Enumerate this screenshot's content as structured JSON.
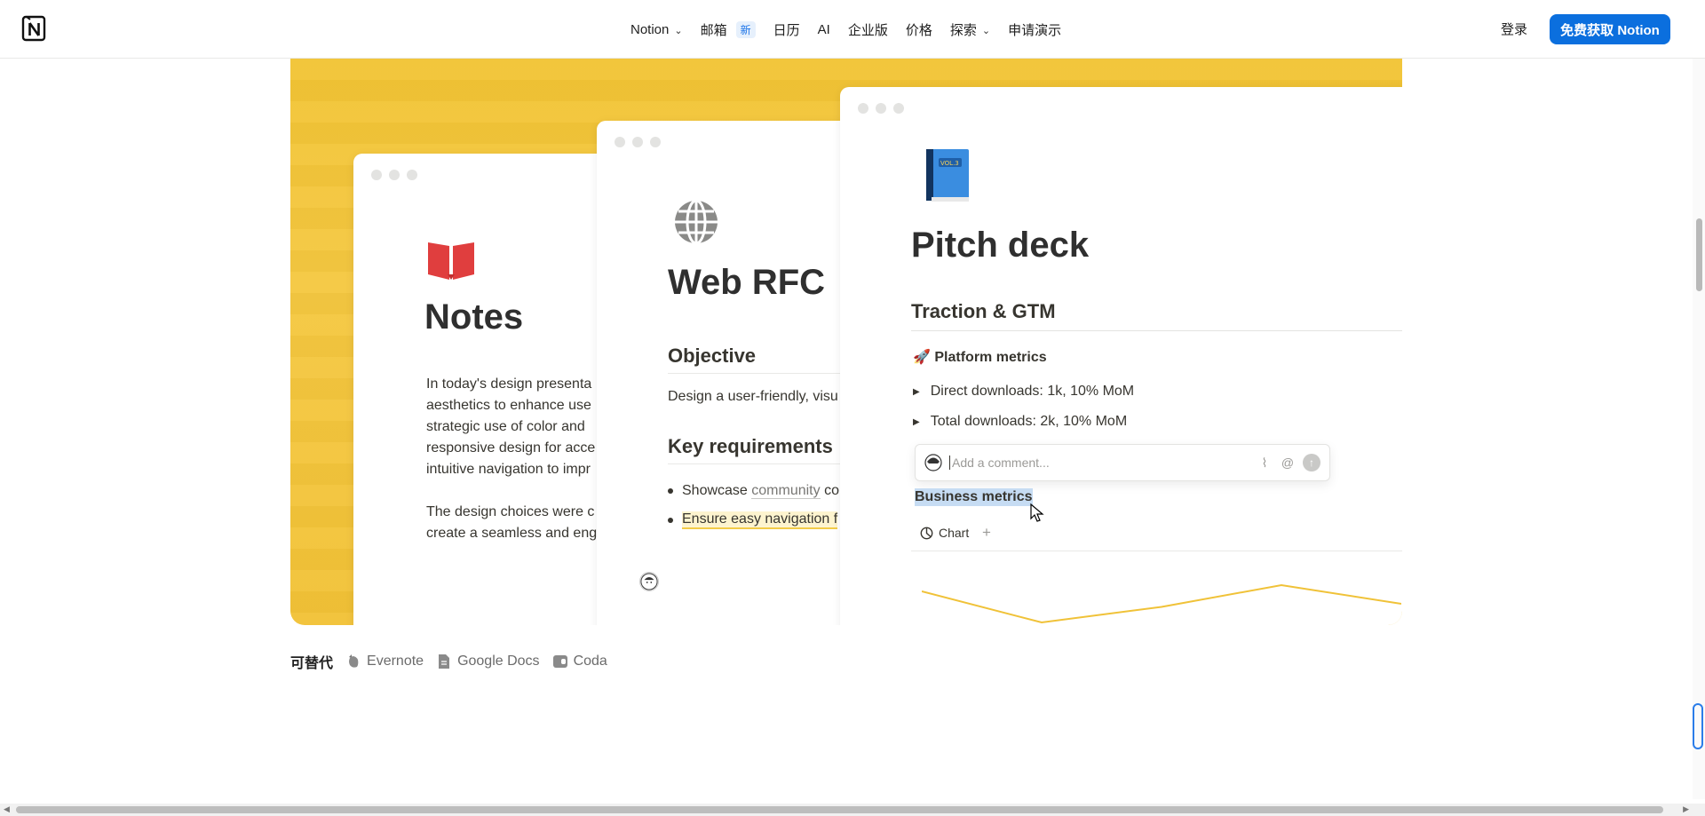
{
  "nav": {
    "items": [
      {
        "label": "Notion",
        "dropdown": true
      },
      {
        "label": "邮箱",
        "badge": "新"
      },
      {
        "label": "日历"
      },
      {
        "label": "AI"
      },
      {
        "label": "企业版"
      },
      {
        "label": "价格"
      },
      {
        "label": "探索",
        "dropdown": true
      },
      {
        "label": "申请演示"
      }
    ],
    "login": "登录",
    "cta": "免费获取 Notion"
  },
  "cards": {
    "notes": {
      "title": "Notes",
      "paragraph1_lines": [
        "In today's design presenta",
        "aesthetics to enhance use",
        "strategic use of color and",
        "responsive design for acce",
        "intuitive navigation to impr"
      ],
      "paragraph2_lines": [
        "The design choices were c",
        "create a seamless and eng"
      ]
    },
    "rfc": {
      "title": "Web RFC",
      "objective_heading": "Objective",
      "objective_text": "Design a user-friendly, visu",
      "key_heading": "Key requirements",
      "bullet1_prefix": "Showcase ",
      "bullet1_mention": "community",
      "bullet1_suffix": " co",
      "bullet2": "Ensure easy navigation f"
    },
    "pitch": {
      "title": "Pitch deck",
      "section": "Traction & GTM",
      "platform_emoji": "🚀",
      "platform_label": "Platform metrics",
      "toggle1": "Direct downloads: 1k, 10% MoM",
      "toggle2": "Total downloads: 2k, 10% MoM",
      "comment_placeholder": "Add a comment...",
      "business_metrics": "Business metrics",
      "chart_tab": "Chart",
      "chart_plus": "+"
    }
  },
  "alternatives": {
    "label": "可替代",
    "items": [
      "Evernote",
      "Google Docs",
      "Coda"
    ]
  },
  "colors": {
    "hero_bg": "#f2c434",
    "cta_bg": "#0b6fde",
    "notes_icon": "#e03e3e",
    "chart_line": "#f0c238",
    "selection": "#c6dcf3"
  },
  "chart_data": {
    "type": "line",
    "series": [
      {
        "values": [
          60,
          10,
          35,
          70,
          40
        ]
      }
    ]
  }
}
